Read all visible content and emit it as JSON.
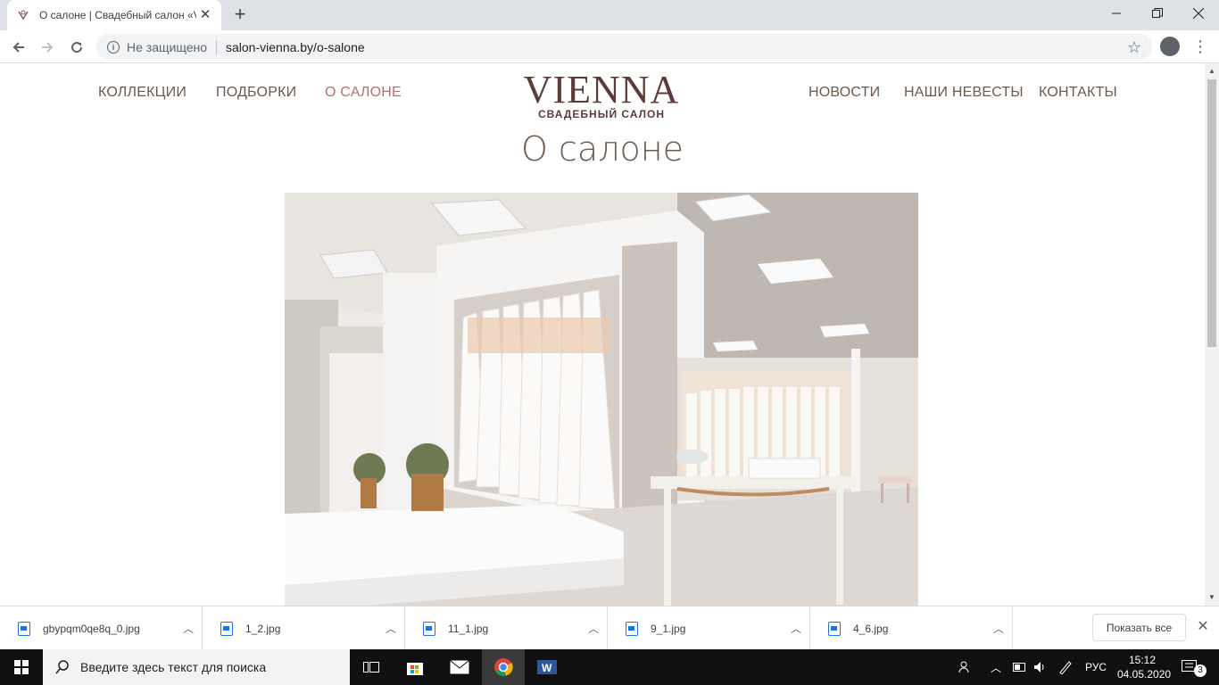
{
  "browser": {
    "tab_title": "О салоне | Свадебный салон «V",
    "security_text": "Не защищено",
    "url": "salon-vienna.by/o-salone"
  },
  "site": {
    "nav_left": [
      "КОЛЛЕКЦИИ",
      "ПОДБОРКИ",
      "О САЛОНЕ"
    ],
    "nav_right": [
      "НОВОСТИ",
      "НАШИ НЕВЕСТЫ",
      "КОНТАКТЫ"
    ],
    "active_item": "О САЛОНЕ",
    "logo_main": "VIENNA",
    "logo_sub": "СВАДЕБНЫЙ САЛОН",
    "page_title": "О салоне",
    "accent_color": "#b56f70",
    "text_color": "#6b5a4e"
  },
  "downloads": {
    "items": [
      "gbypqm0qe8q_0.jpg",
      "1_2.jpg",
      "11_1.jpg",
      "9_1.jpg",
      "4_6.jpg"
    ],
    "show_all": "Показать все"
  },
  "taskbar": {
    "search_placeholder": "Введите здесь текст для поиска",
    "language": "РУС",
    "time": "15:12",
    "date": "04.05.2020",
    "notifications": "3"
  }
}
